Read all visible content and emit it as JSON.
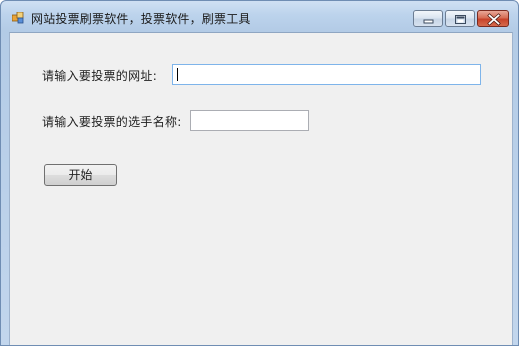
{
  "window": {
    "title": "网站投票刷票软件，投票软件，刷票工具",
    "app_icon": "app-icon",
    "controls": [
      "minimize-icon",
      "maximize-icon",
      "close-icon"
    ]
  },
  "form": {
    "url_label": "请输入要投票的网址:",
    "url_value": "",
    "name_label": "请输入要投票的选手名称:",
    "name_value": "",
    "start_button": "开始"
  },
  "colors": {
    "client_bg": "#f0f0f0",
    "frame": "#bcd3ec",
    "focus_border": "#7eb4ea",
    "close_button": "#c8432a"
  }
}
